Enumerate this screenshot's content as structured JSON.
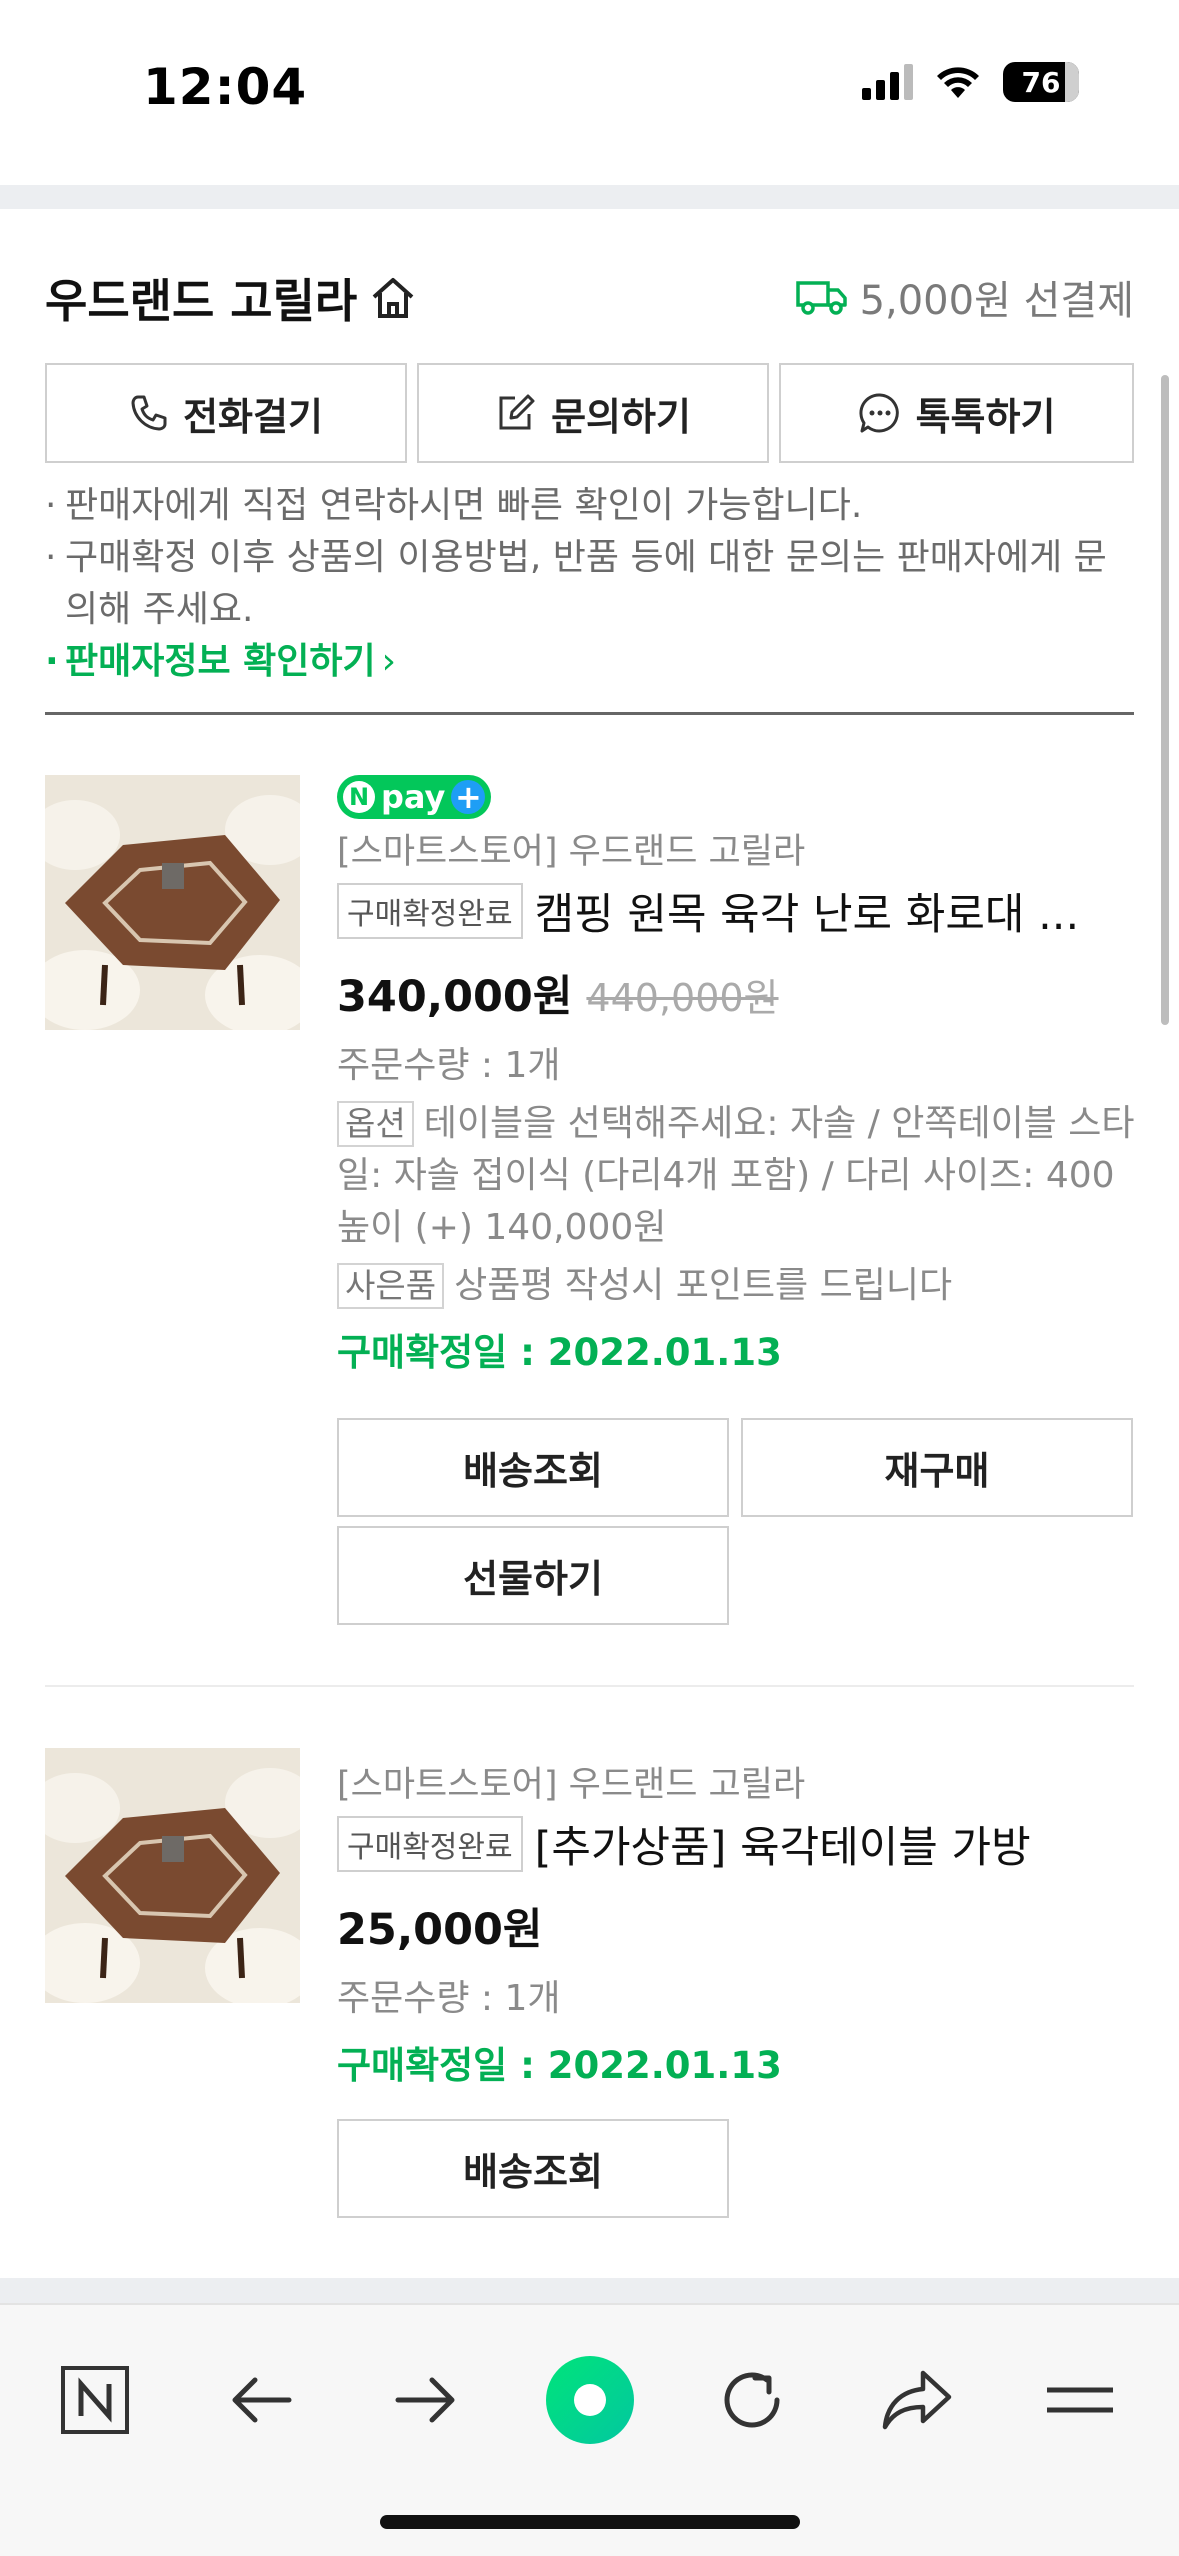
{
  "status_bar": {
    "time": "12:04",
    "battery": "76"
  },
  "seller": {
    "name": "우드랜드 고릴라",
    "shipping_text": "5,000원 선결제"
  },
  "actions": {
    "call": "전화걸기",
    "inquiry": "문의하기",
    "talk": "톡톡하기"
  },
  "notes": [
    "판매자에게 직접 연락하시면 빠른 확인이 가능합니다.",
    "구매확정 이후 상품의 이용방법, 반품 등에 대한 문의는 판매자에게 문의해 주세요."
  ],
  "seller_info_link": "판매자정보 확인하기",
  "orders": [
    {
      "badge_npay": "pay",
      "store": "[스마트스토어] 우드랜드 고릴라",
      "status_tag": "구매확정완료",
      "title": "캠핑 원목 육각 난로 화로대 ...",
      "price": "340,000원",
      "original_price": "440,000원",
      "quantity": "주문수량 : 1개",
      "option_label": "옵션",
      "option_text": "테이블을 선택해주세요: 자솔 / 안쪽테이블 스타일: 자솔 접이식 (다리4개 포함) / 다리 사이즈: 400 높이 (+) 140,000원",
      "gift_label": "사은품",
      "gift_text": "상품평 작성시 포인트를 드립니다",
      "confirm_date": "구매확정일 : 2022.01.13",
      "buttons": [
        "배송조회",
        "재구매",
        "선물하기"
      ]
    },
    {
      "store": "[스마트스토어] 우드랜드 고릴라",
      "status_tag": "구매확정완료",
      "title": "[추가상품] 육각테이블 가방",
      "price": "25,000원",
      "quantity": "주문수량 : 1개",
      "confirm_date": "구매확정일 : 2022.01.13",
      "buttons": [
        "배송조회"
      ]
    }
  ],
  "colors": {
    "accent_green": "#03b054",
    "npay_green": "#03c75a",
    "npay_blue": "#1e9ef5"
  },
  "toolbar_icons": [
    "naver-n-icon",
    "back-arrow-icon",
    "forward-arrow-icon",
    "green-dot-icon",
    "reload-icon",
    "share-icon",
    "menu-icon"
  ]
}
